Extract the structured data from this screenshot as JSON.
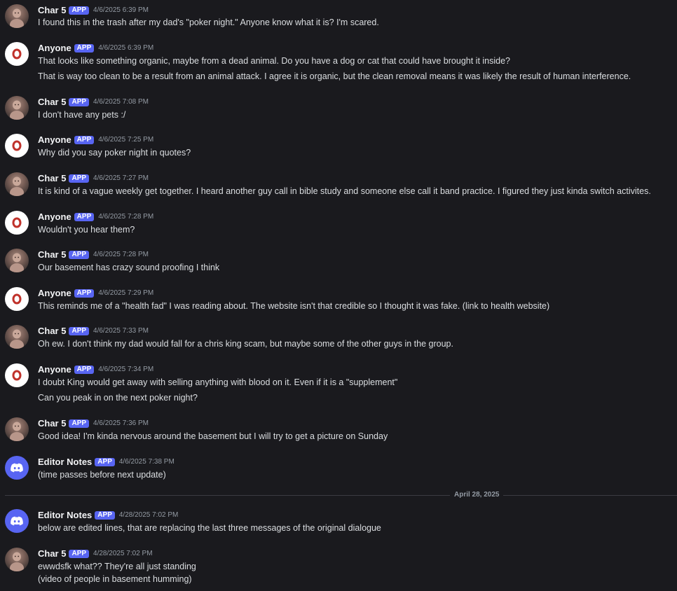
{
  "app_badge": "APP",
  "colors": {
    "background": "#1a1a1e",
    "badge": "#5865f2",
    "text": "#dbdee1",
    "timestamp": "#949ba4"
  },
  "icons": {
    "char5": "bald-figure-avatar-icon",
    "anyone": "red-ring-avatar-icon",
    "editor": "discord-logo-icon"
  },
  "messages": [
    {
      "author": "Char 5",
      "time": "4/6/2025 6:39 PM",
      "lines": [
        "I found this in the trash after my dad's \"poker night.\" Anyone know what it is? I'm scared."
      ]
    },
    {
      "author": "Anyone",
      "time": "4/6/2025 6:39 PM",
      "lines": [
        "That looks like something organic, maybe from a dead animal. Do you have a dog or cat that could have brought it inside?",
        "That is way too clean to be a result from an animal attack. I agree it is organic, but the clean removal means it was likely the result of human interference."
      ]
    },
    {
      "author": "Char 5",
      "time": "4/6/2025 7:08 PM",
      "lines": [
        "I don't have any pets :/"
      ]
    },
    {
      "author": "Anyone",
      "time": "4/6/2025 7:25 PM",
      "lines": [
        "Why did you say poker night in quotes?"
      ]
    },
    {
      "author": "Char 5",
      "time": "4/6/2025 7:27 PM",
      "lines": [
        "It is kind of a vague weekly get together. I heard another guy call in bible study and someone else call it band practice. I figured they just kinda switch activites."
      ]
    },
    {
      "author": "Anyone",
      "time": "4/6/2025 7:28 PM",
      "lines": [
        "Wouldn't you hear them?"
      ]
    },
    {
      "author": "Char 5",
      "time": "4/6/2025 7:28 PM",
      "lines": [
        "Our basement has crazy sound proofing I think"
      ]
    },
    {
      "author": "Anyone",
      "time": "4/6/2025 7:29 PM",
      "lines": [
        "This reminds me of a \"health fad\" I was reading about. The website isn't that credible so I thought it was fake. (link to health website)"
      ]
    },
    {
      "author": "Char 5",
      "time": "4/6/2025 7:33 PM",
      "lines": [
        "Oh ew. I don't think my dad would fall for a chris king scam, but maybe some of the other guys in the group."
      ]
    },
    {
      "author": "Anyone",
      "time": "4/6/2025 7:34 PM",
      "lines": [
        "I doubt King would get away with selling anything with blood on it. Even if it is a \"supplement\"",
        "Can you peak in on the next poker night?"
      ]
    },
    {
      "author": "Char 5",
      "time": "4/6/2025 7:36 PM",
      "lines": [
        "Good idea! I'm kinda nervous around the basement but I will try to get a picture on Sunday"
      ]
    },
    {
      "author": "Editor Notes",
      "time": "4/6/2025 7:38 PM",
      "lines": [
        "(time passes before next update)"
      ]
    },
    {
      "author": "Editor Notes",
      "time": "4/28/2025 7:02 PM",
      "lines": [
        "below are edited lines, that are replacing the last three messages of the original dialogue"
      ]
    },
    {
      "author": "Char 5",
      "time": "4/28/2025 7:02 PM",
      "lines": [
        "ewwdsfk what?? They're all just standing",
        "(video of people in basement humming)"
      ]
    }
  ],
  "date_divider": "April 28, 2025"
}
